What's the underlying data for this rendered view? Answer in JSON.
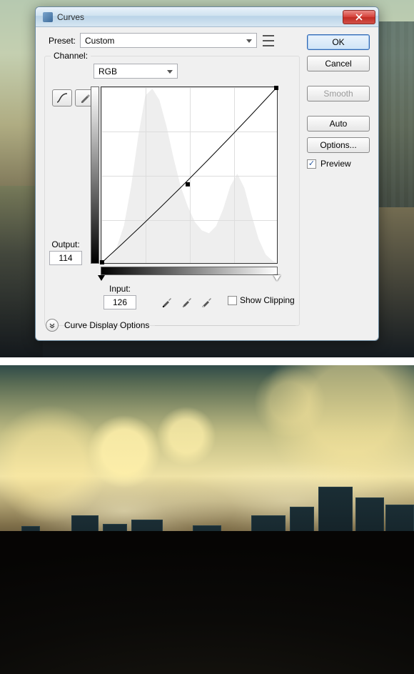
{
  "dialog": {
    "title": "Curves",
    "preset": {
      "label": "Preset:",
      "value": "Custom"
    },
    "channel": {
      "label": "Channel:",
      "value": "RGB"
    },
    "output": {
      "label": "Output:",
      "value": "114"
    },
    "input": {
      "label": "Input:",
      "value": "126"
    },
    "show_clipping": {
      "label": "Show Clipping",
      "checked": false
    },
    "curve_display_options_label": "Curve Display Options",
    "buttons": {
      "ok": "OK",
      "cancel": "Cancel",
      "smooth": "Smooth",
      "auto": "Auto",
      "options": "Options..."
    },
    "preview": {
      "label": "Preview",
      "checked": true
    }
  },
  "chart_data": {
    "type": "line",
    "title": "Curves adjustment",
    "xlabel": "Input",
    "ylabel": "Output",
    "xlim": [
      0,
      255
    ],
    "ylim": [
      0,
      255
    ],
    "series": [
      {
        "name": "RGB curve",
        "x": [
          0,
          126,
          255
        ],
        "y": [
          0,
          114,
          255
        ]
      }
    ],
    "control_point": {
      "input": 126,
      "output": 114
    },
    "sliders": {
      "black": 0,
      "white": 255
    },
    "histogram_approx": [
      0,
      0,
      2,
      6,
      14,
      30,
      62,
      110,
      170,
      225,
      245,
      230,
      195,
      155,
      120,
      92,
      70,
      55,
      44,
      36,
      30,
      27,
      30,
      42,
      66,
      92,
      110,
      96,
      70,
      48,
      30,
      18,
      10,
      5,
      2,
      0
    ]
  }
}
